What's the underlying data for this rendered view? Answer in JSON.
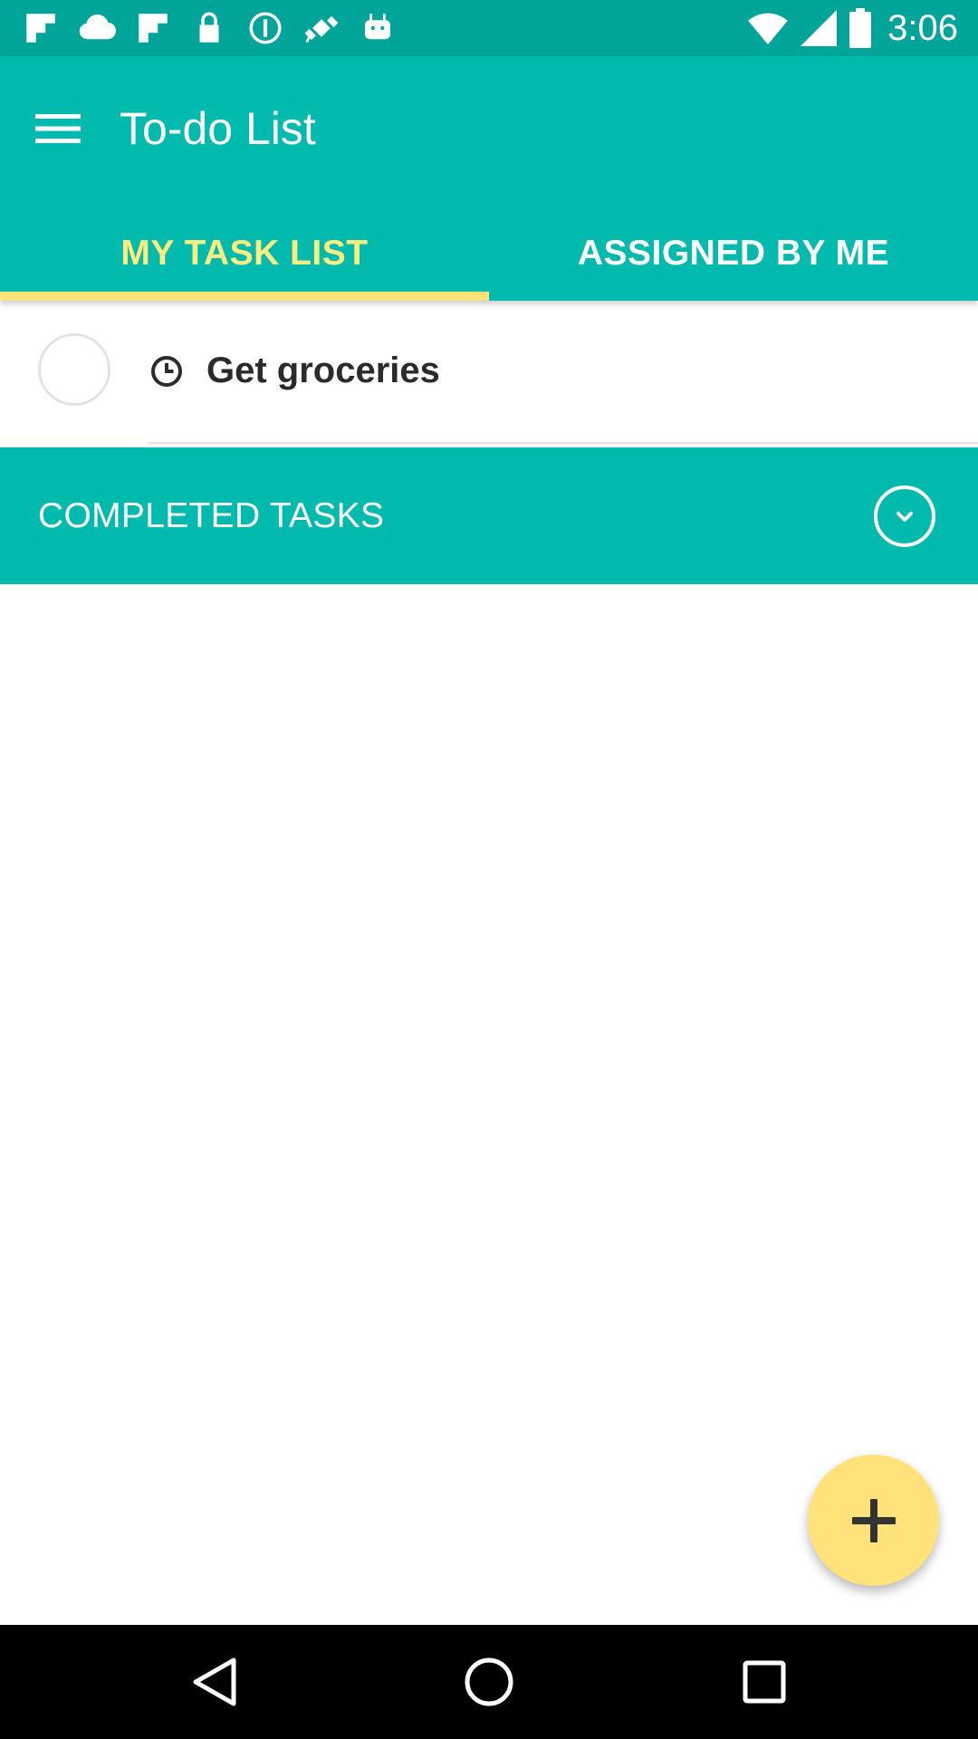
{
  "status_bar": {
    "time": "3:06",
    "left_icons": [
      "flipboard-icon",
      "cloud-icon",
      "flipboard-icon",
      "lock-icon",
      "info-circle-icon",
      "satellite-fake-gps-icon",
      "android-icon"
    ],
    "right_icons": [
      "wifi-icon",
      "signal-icon",
      "battery-icon"
    ]
  },
  "app_bar": {
    "title": "To-do List",
    "menu_icon": "hamburger-menu-icon"
  },
  "tabs": [
    {
      "label": "MY TASK LIST",
      "active": true
    },
    {
      "label": "ASSIGNED BY ME",
      "active": false
    }
  ],
  "tasks": [
    {
      "title": "Get groceries",
      "completed": false,
      "icon": "clock-icon"
    }
  ],
  "completed_section": {
    "label": "COMPLETED TASKS",
    "toggle_icon": "chevron-down-circle-icon"
  },
  "fab": {
    "icon": "plus-icon"
  },
  "nav_bar": {
    "buttons": [
      "back-icon",
      "home-icon",
      "recents-icon"
    ]
  },
  "colors": {
    "status_bar": "#00a499",
    "primary": "#00bbad",
    "accent": "#ffe37a",
    "active_tab_text": "#ffec80"
  }
}
